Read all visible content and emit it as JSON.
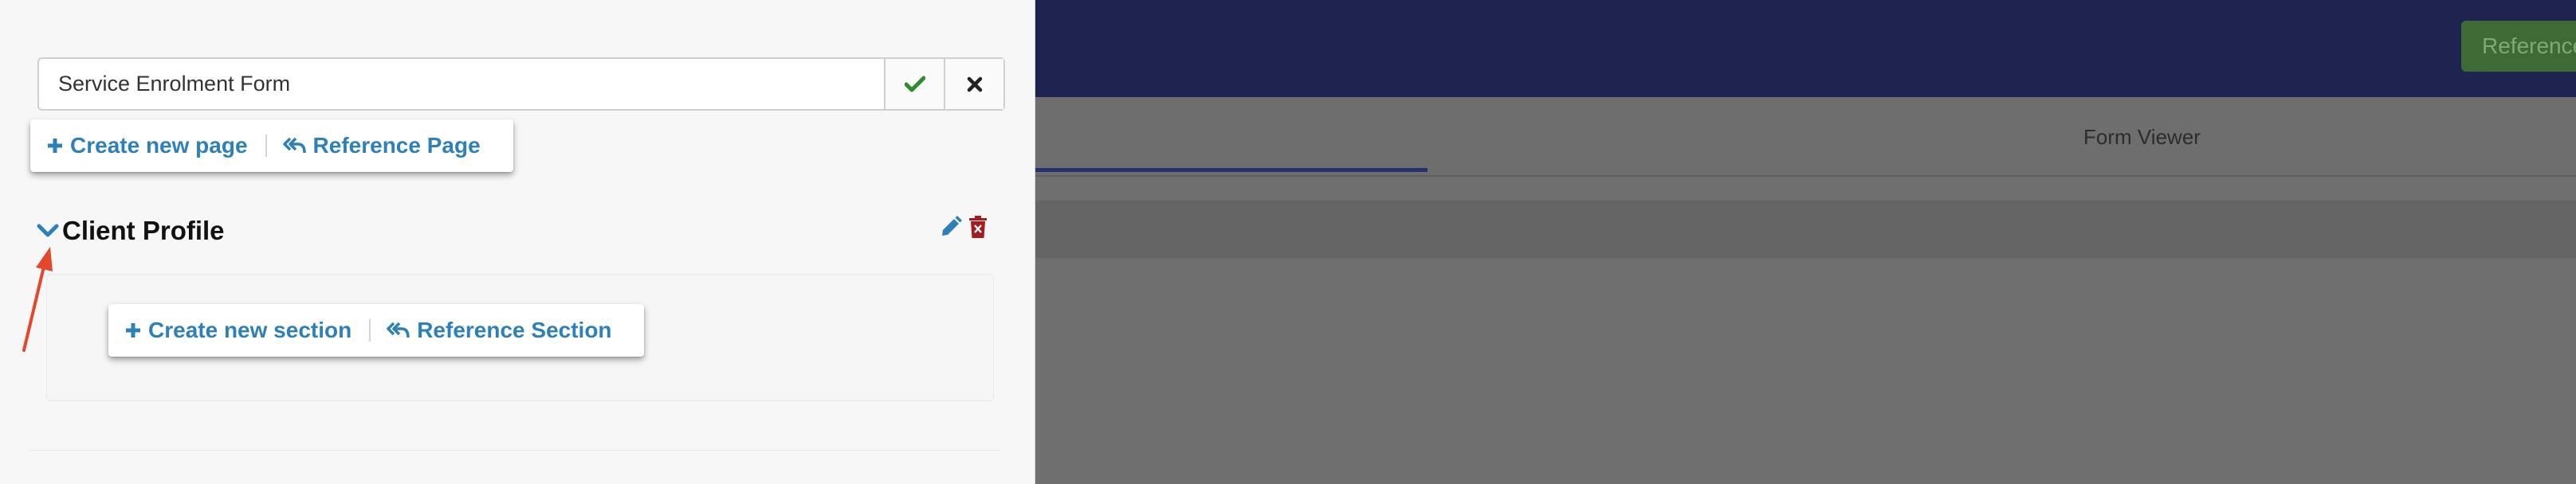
{
  "background": {
    "reference_button_label": "Reference",
    "tabs": [
      {
        "label": ""
      },
      {
        "label": "Form Viewer"
      }
    ]
  },
  "drawer": {
    "form_name_value": "Service Enrolment Form",
    "form_name_placeholder": "",
    "page_toolbar": {
      "create_label": "Create new page",
      "reference_label": "Reference Page"
    },
    "page": {
      "title": "Client Profile",
      "expanded": true
    },
    "section_toolbar": {
      "create_label": "Create new section",
      "reference_label": "Reference Section"
    }
  },
  "icons": {
    "confirm": "check-icon",
    "cancel": "close-icon",
    "add": "plus-icon",
    "reference": "reply-all-icon",
    "collapse": "chevron-down-icon",
    "edit": "pencil-icon",
    "delete": "trash-icon"
  },
  "colors": {
    "accent": "#2e80b8",
    "confirm": "#2e8b2e",
    "delete": "#a51c1c",
    "topbar": "#1f2350",
    "annotation_arrow": "#e5472c"
  }
}
